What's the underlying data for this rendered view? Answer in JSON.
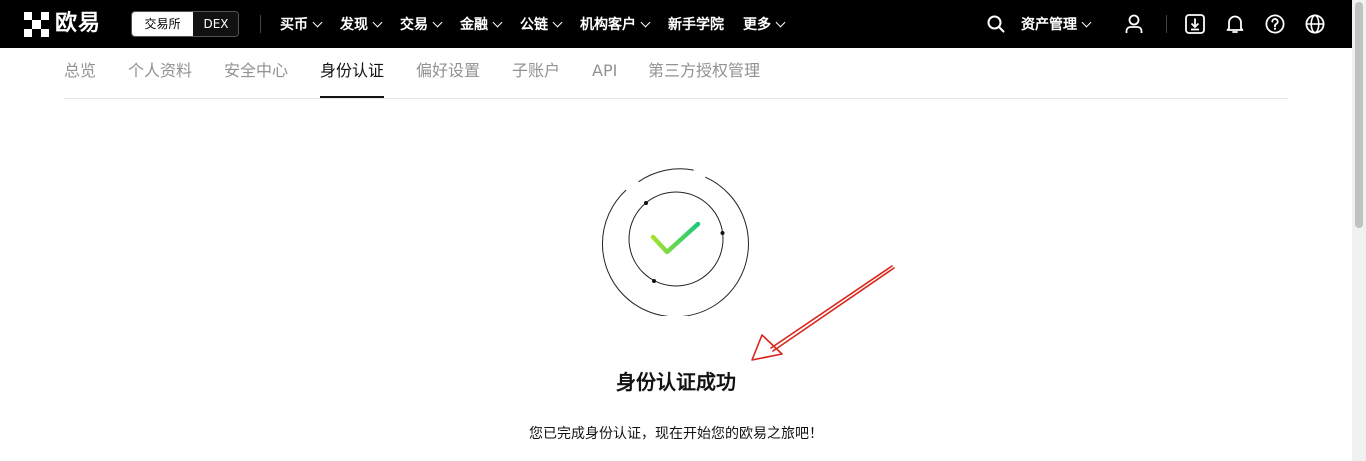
{
  "brand": {
    "name": "欧易"
  },
  "mode_switch": {
    "exchange": "交易所",
    "dex": "DEX"
  },
  "nav": {
    "items": [
      {
        "label": "买币",
        "dropdown": true
      },
      {
        "label": "发现",
        "dropdown": true
      },
      {
        "label": "交易",
        "dropdown": true
      },
      {
        "label": "金融",
        "dropdown": true
      },
      {
        "label": "公链",
        "dropdown": true
      },
      {
        "label": "机构客户",
        "dropdown": true
      },
      {
        "label": "新手学院",
        "dropdown": false
      },
      {
        "label": "更多",
        "dropdown": true
      }
    ],
    "asset_management": "资产管理",
    "icons": [
      "search-icon",
      "user-icon",
      "download-icon",
      "bell-icon",
      "help-icon",
      "globe-icon"
    ]
  },
  "tabs": [
    {
      "label": "总览",
      "active": false
    },
    {
      "label": "个人资料",
      "active": false
    },
    {
      "label": "安全中心",
      "active": false
    },
    {
      "label": "身份认证",
      "active": true
    },
    {
      "label": "偏好设置",
      "active": false
    },
    {
      "label": "子账户",
      "active": false
    },
    {
      "label": "API",
      "active": false
    },
    {
      "label": "第三方授权管理",
      "active": false
    }
  ],
  "result": {
    "title": "身份认证成功",
    "description": "您已完成身份认证，现在开始您的欧易之旅吧！"
  },
  "colors": {
    "nav_bg": "#000000",
    "check_start": "#a6e22e",
    "check_end": "#1ec97a",
    "annotation_arrow": "#d9261c"
  }
}
